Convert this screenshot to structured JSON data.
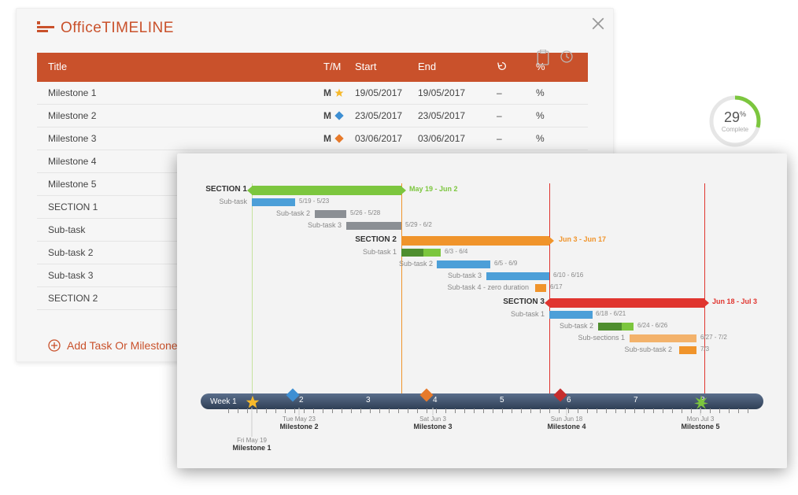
{
  "brand": {
    "office": "Office",
    "timeline": "TIMELINE"
  },
  "header": {
    "title": "Title",
    "tm": "T/M",
    "start": "Start",
    "end": "End",
    "dur": "↺",
    "pct": "%"
  },
  "rows": [
    {
      "title": "Milestone 1",
      "tm": "M",
      "shape": "star",
      "color": "#F6B92B",
      "start": "19/05/2017",
      "end": "19/05/2017",
      "dur": "–",
      "pct": "%"
    },
    {
      "title": "Milestone 2",
      "tm": "M",
      "shape": "diamond",
      "color": "#3E8FD3",
      "start": "23/05/2017",
      "end": "23/05/2017",
      "dur": "–",
      "pct": "%"
    },
    {
      "title": "Milestone 3",
      "tm": "M",
      "shape": "diamond",
      "color": "#E77A2B",
      "start": "03/06/2017",
      "end": "03/06/2017",
      "dur": "–",
      "pct": "%"
    },
    {
      "title": "Milestone 4",
      "tm": "",
      "shape": "",
      "color": "",
      "start": "",
      "end": "",
      "dur": "",
      "pct": ""
    },
    {
      "title": "Milestone 5",
      "tm": "",
      "shape": "",
      "color": "",
      "start": "",
      "end": "",
      "dur": "",
      "pct": ""
    },
    {
      "title": "SECTION 1",
      "tm": "",
      "shape": "",
      "color": "",
      "start": "",
      "end": "",
      "dur": "",
      "pct": ""
    },
    {
      "title": "Sub-task",
      "tm": "",
      "shape": "",
      "color": "",
      "start": "",
      "end": "",
      "dur": "",
      "pct": ""
    },
    {
      "title": "Sub-task 2",
      "tm": "",
      "shape": "",
      "color": "",
      "start": "",
      "end": "",
      "dur": "",
      "pct": ""
    },
    {
      "title": "Sub-task 3",
      "tm": "",
      "shape": "",
      "color": "",
      "start": "",
      "end": "",
      "dur": "",
      "pct": ""
    },
    {
      "title": "SECTION 2",
      "tm": "",
      "shape": "",
      "color": "",
      "start": "",
      "end": "",
      "dur": "",
      "pct": ""
    }
  ],
  "add": "Add Task Or Milestone",
  "progress": {
    "pct": "29",
    "sym": "%",
    "label": "Complete"
  },
  "gantt": {
    "sections": [
      {
        "name": "SECTION 1",
        "range": "May 19 - Jun 2",
        "color": "#7CC63E"
      },
      {
        "name": "SECTION 2",
        "range": "Jun 3 - Jun 17",
        "color": "#F0942B"
      },
      {
        "name": "SECTION 3",
        "range": "Jun 18 - Jul 3",
        "color": "#E0352F"
      }
    ],
    "tasks": {
      "s1": [
        {
          "name": "Sub-task",
          "dates": "5/19 - 5/23"
        },
        {
          "name": "Sub-task 2",
          "dates": "5/26 - 5/28"
        },
        {
          "name": "Sub-task 3",
          "dates": "5/29 - 6/2"
        }
      ],
      "s2": [
        {
          "name": "Sub-task 1",
          "dates": "6/3 - 6/4"
        },
        {
          "name": "Sub-task 2",
          "dates": "6/5 - 6/9"
        },
        {
          "name": "Sub-task 3",
          "dates": "6/10 - 6/16"
        },
        {
          "name": "Sub-task 4 - zero duration",
          "dates": "6/17"
        }
      ],
      "s3": [
        {
          "name": "Sub-task 1",
          "dates": "6/18 - 6/21"
        },
        {
          "name": "Sub-task 2",
          "dates": "6/24 - 6/26"
        },
        {
          "name": "Sub-sections 1",
          "dates": "6/27 - 7/2"
        },
        {
          "name": "Sub-sub-task 2",
          "dates": "7/3"
        }
      ]
    },
    "milestones": [
      {
        "name": "Milestone 1",
        "date": "Fri May 19",
        "shape": "star",
        "color": "#F6B92B",
        "wk": 1
      },
      {
        "name": "Milestone 2",
        "date": "Tue May 23",
        "shape": "diamond",
        "color": "#3E8FD3",
        "wk": 2
      },
      {
        "name": "Milestone 3",
        "date": "Sat Jun 3",
        "shape": "diamond",
        "color": "#E77A2B",
        "wk": 4
      },
      {
        "name": "Milestone 4",
        "date": "Sun Jun 18",
        "shape": "diamond",
        "color": "#C62D2D",
        "wk": 6
      },
      {
        "name": "Milestone 5",
        "date": "Mon Jul 3",
        "shape": "burst",
        "color": "#7CC63E",
        "wk": 8
      }
    ],
    "axis": {
      "label": "Week 1",
      "ticks": [
        "2",
        "3",
        "4",
        "5",
        "6",
        "7",
        "8"
      ]
    }
  },
  "colors": {
    "blue": "#4C9FD8",
    "gray": "#8B8F94",
    "orange": "#F0942B",
    "lorange": "#F3B26B",
    "green": "#7CC63E",
    "dgreen": "#4F8E2F"
  }
}
